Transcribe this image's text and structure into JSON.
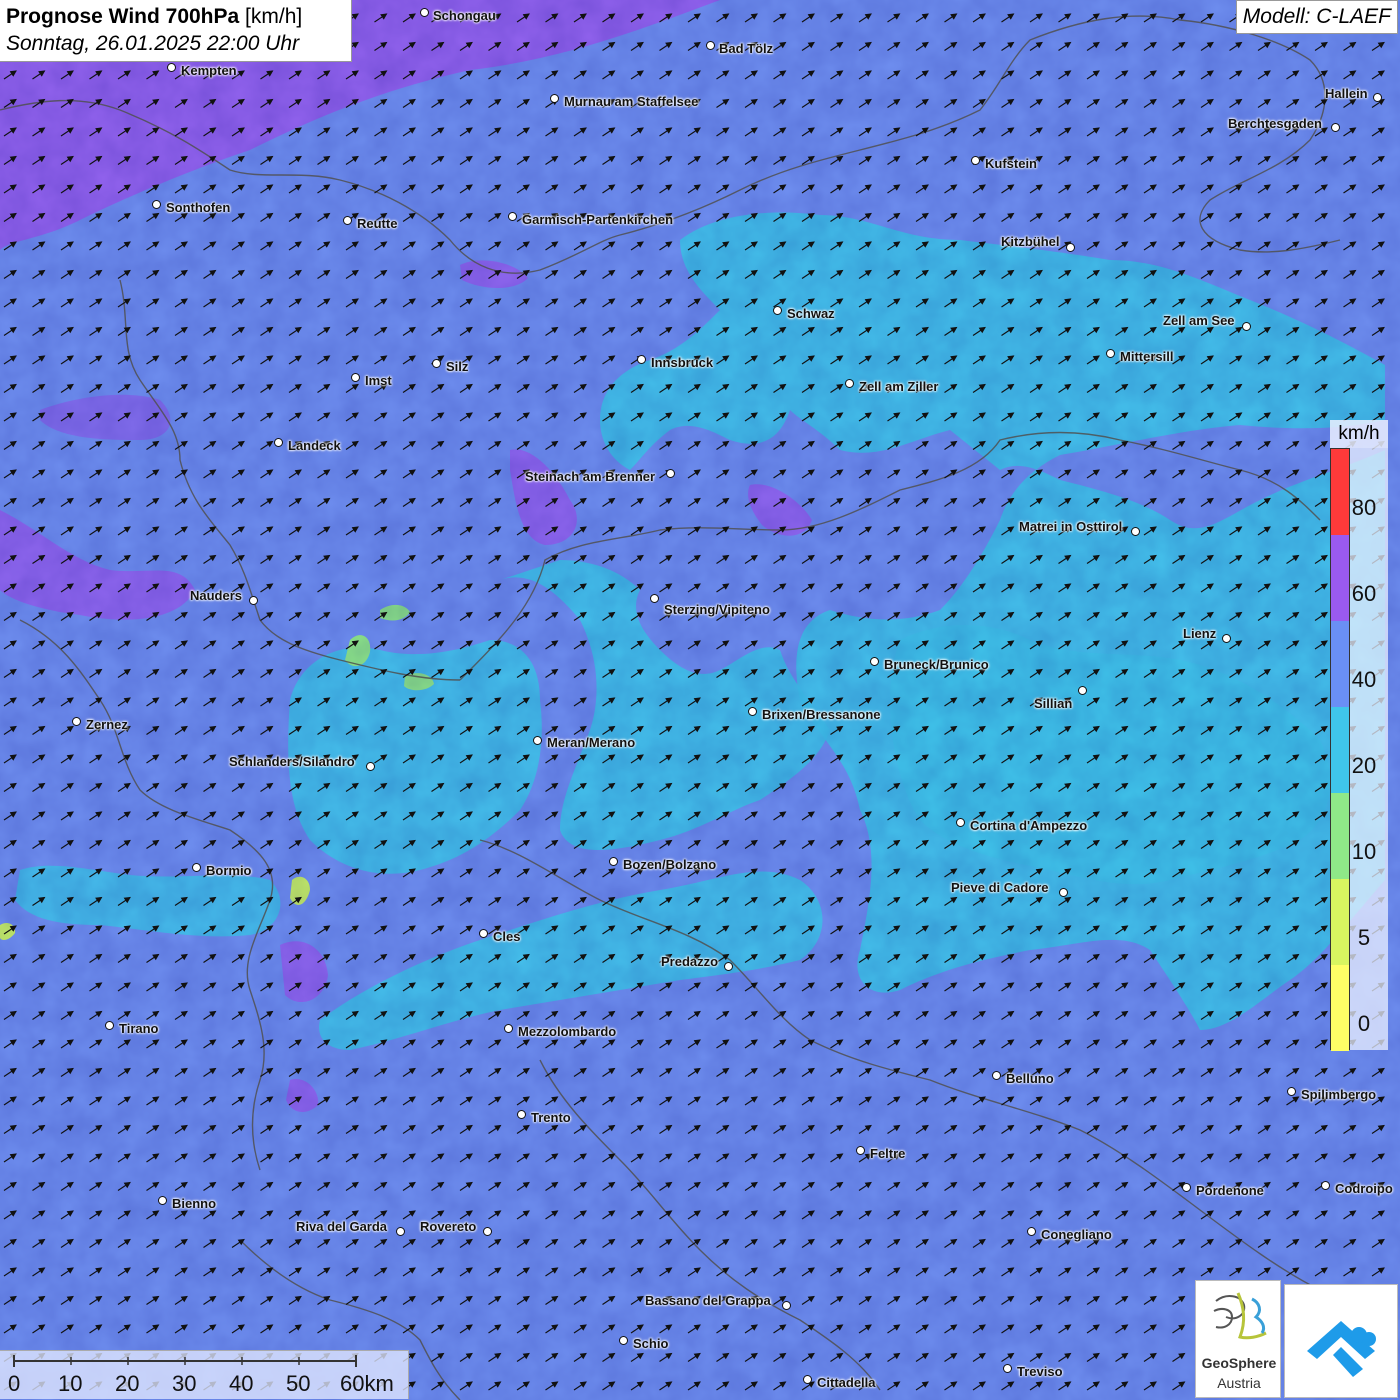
{
  "title": {
    "main": "Prognose Wind 700hPa",
    "unit": "[km/h]",
    "date": "Sonntag, 26.01.2025 22:00 Uhr"
  },
  "model": "Modell: C-LAEF",
  "cities": [
    {
      "name": "Schongau",
      "dot": [
        425,
        13
      ],
      "label": [
        433,
        8
      ]
    },
    {
      "name": "Bad Tölz",
      "dot": [
        711,
        46
      ],
      "label": [
        719,
        41
      ]
    },
    {
      "name": "Kempten",
      "dot": [
        172,
        68
      ],
      "label": [
        181,
        63
      ]
    },
    {
      "name": "Murnau am Staffelsee",
      "dot": [
        555,
        99
      ],
      "label": [
        564,
        94
      ]
    },
    {
      "name": "Hallein",
      "dot": [
        1378,
        98
      ],
      "label": [
        1325,
        86
      ]
    },
    {
      "name": "Berchtesgaden",
      "dot": [
        1336,
        128
      ],
      "label": [
        1228,
        116
      ]
    },
    {
      "name": "Kufstein",
      "dot": [
        976,
        161
      ],
      "label": [
        985,
        156
      ]
    },
    {
      "name": "Sonthofen",
      "dot": [
        157,
        205
      ],
      "label": [
        166,
        200
      ]
    },
    {
      "name": "Reutte",
      "dot": [
        348,
        221
      ],
      "label": [
        357,
        216
      ]
    },
    {
      "name": "Garmisch-Partenkirchen",
      "dot": [
        513,
        217
      ],
      "label": [
        522,
        212
      ]
    },
    {
      "name": "Kitzbühel",
      "dot": [
        1071,
        248
      ],
      "label": [
        1001,
        234
      ]
    },
    {
      "name": "Schwaz",
      "dot": [
        778,
        311
      ],
      "label": [
        787,
        306
      ]
    },
    {
      "name": "Zell am See",
      "dot": [
        1247,
        327
      ],
      "label": [
        1163,
        313
      ]
    },
    {
      "name": "Mittersill",
      "dot": [
        1111,
        354
      ],
      "label": [
        1120,
        349
      ]
    },
    {
      "name": "Innsbruck",
      "dot": [
        642,
        360
      ],
      "label": [
        651,
        355
      ]
    },
    {
      "name": "Silz",
      "dot": [
        437,
        364
      ],
      "label": [
        446,
        359
      ]
    },
    {
      "name": "Imst",
      "dot": [
        356,
        378
      ],
      "label": [
        365,
        373
      ]
    },
    {
      "name": "Zell am Ziller",
      "dot": [
        850,
        384
      ],
      "label": [
        859,
        379
      ]
    },
    {
      "name": "Landeck",
      "dot": [
        279,
        443
      ],
      "label": [
        288,
        438
      ]
    },
    {
      "name": "Steinach am Brenner",
      "dot": [
        671,
        474
      ],
      "label": [
        525,
        469
      ]
    },
    {
      "name": "Matrei in Osttirol",
      "dot": [
        1136,
        532
      ],
      "label": [
        1019,
        519
      ]
    },
    {
      "name": "Nauders",
      "dot": [
        254,
        601
      ],
      "label": [
        190,
        588
      ]
    },
    {
      "name": "Sterzing/Vipiteno",
      "dot": [
        655,
        599
      ],
      "label": [
        664,
        602
      ]
    },
    {
      "name": "Lienz",
      "dot": [
        1227,
        639
      ],
      "label": [
        1183,
        626
      ]
    },
    {
      "name": "Bruneck/Brunico",
      "dot": [
        875,
        662
      ],
      "label": [
        884,
        657
      ]
    },
    {
      "name": "Sillian",
      "dot": [
        1083,
        691
      ],
      "label": [
        1034,
        696
      ]
    },
    {
      "name": "Brixen/Bressanone",
      "dot": [
        753,
        712
      ],
      "label": [
        762,
        707
      ]
    },
    {
      "name": "Zernez",
      "dot": [
        77,
        722
      ],
      "label": [
        86,
        717
      ]
    },
    {
      "name": "Meran/Merano",
      "dot": [
        538,
        741
      ],
      "label": [
        547,
        735
      ]
    },
    {
      "name": "Schlanders/Silandro",
      "dot": [
        371,
        767
      ],
      "label": [
        229,
        754
      ]
    },
    {
      "name": "Cortina d'Ampezzo",
      "dot": [
        961,
        823
      ],
      "label": [
        970,
        818
      ]
    },
    {
      "name": "Bozen/Bolzano",
      "dot": [
        614,
        862
      ],
      "label": [
        623,
        857
      ]
    },
    {
      "name": "Bormio",
      "dot": [
        197,
        868
      ],
      "label": [
        206,
        863
      ]
    },
    {
      "name": "Pieve di Cadore",
      "dot": [
        1064,
        893
      ],
      "label": [
        951,
        880
      ]
    },
    {
      "name": "Cles",
      "dot": [
        484,
        934
      ],
      "label": [
        493,
        929
      ]
    },
    {
      "name": "Predazzo",
      "dot": [
        729,
        967
      ],
      "label": [
        661,
        954
      ]
    },
    {
      "name": "Tirano",
      "dot": [
        110,
        1026
      ],
      "label": [
        119,
        1021
      ]
    },
    {
      "name": "Mezzolombardo",
      "dot": [
        509,
        1029
      ],
      "label": [
        518,
        1024
      ]
    },
    {
      "name": "Belluno",
      "dot": [
        997,
        1076
      ],
      "label": [
        1006,
        1071
      ]
    },
    {
      "name": "Spilimbergo",
      "dot": [
        1292,
        1092
      ],
      "label": [
        1301,
        1087
      ]
    },
    {
      "name": "Trento",
      "dot": [
        522,
        1115
      ],
      "label": [
        531,
        1110
      ]
    },
    {
      "name": "Feltre",
      "dot": [
        861,
        1151
      ],
      "label": [
        870,
        1146
      ]
    },
    {
      "name": "Pordenone",
      "dot": [
        1187,
        1188
      ],
      "label": [
        1196,
        1183
      ]
    },
    {
      "name": "Codroipo",
      "dot": [
        1326,
        1186
      ],
      "label": [
        1335,
        1181
      ]
    },
    {
      "name": "Bienno",
      "dot": [
        163,
        1201
      ],
      "label": [
        172,
        1196
      ]
    },
    {
      "name": "Riva del Garda",
      "dot": [
        401,
        1232
      ],
      "label": [
        296,
        1219
      ]
    },
    {
      "name": "Rovereto",
      "dot": [
        488,
        1232
      ],
      "label": [
        420,
        1219
      ]
    },
    {
      "name": "Conegliano",
      "dot": [
        1032,
        1232
      ],
      "label": [
        1041,
        1227
      ]
    },
    {
      "name": "Bassano del Grappa",
      "dot": [
        787,
        1306
      ],
      "label": [
        645,
        1293
      ]
    },
    {
      "name": "Schio",
      "dot": [
        624,
        1341
      ],
      "label": [
        633,
        1336
      ]
    },
    {
      "name": "Treviso",
      "dot": [
        1008,
        1369
      ],
      "label": [
        1017,
        1364
      ]
    },
    {
      "name": "Cittadella",
      "dot": [
        808,
        1380
      ],
      "label": [
        817,
        1375
      ]
    }
  ],
  "legend": {
    "unit": "km/h",
    "classes": [
      {
        "label": "80",
        "color": "#ff3a3a"
      },
      {
        "label": "60",
        "color": "#9a5af0"
      },
      {
        "label": "40",
        "color": "#6a8ff5"
      },
      {
        "label": "20",
        "color": "#3fc6ea"
      },
      {
        "label": "10",
        "color": "#8fe888"
      },
      {
        "label": "5",
        "color": "#d8f560"
      },
      {
        "label": "0",
        "color": "#ffff66"
      }
    ]
  },
  "scale": {
    "ticks": [
      "0",
      "10",
      "20",
      "30",
      "40",
      "50",
      "60km"
    ]
  },
  "logo": {
    "name": "GeoSphere",
    "sub": "Austria"
  },
  "colors": {
    "background": "#6f8ff0",
    "wind_20_40": "#40c4ea",
    "wind_60_80": "#9560ee",
    "border": "#555555",
    "arrow": "#111111"
  },
  "icons": [
    "wind-arrow-icon",
    "geosphere-logo-icon",
    "app-logo-icon"
  ]
}
